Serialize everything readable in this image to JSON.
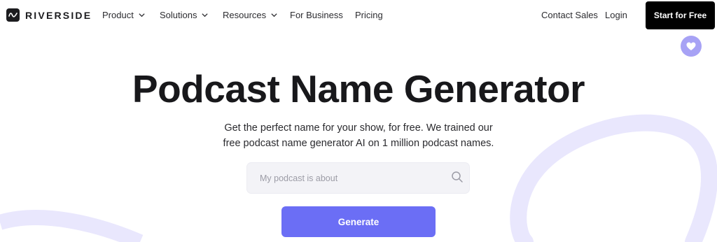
{
  "brand": {
    "name": "RIVERSIDE",
    "logo_icon": "waveform-icon"
  },
  "nav": {
    "items": [
      {
        "label": "Product",
        "has_dropdown": true
      },
      {
        "label": "Solutions",
        "has_dropdown": true
      },
      {
        "label": "Resources",
        "has_dropdown": true
      },
      {
        "label": "For Business",
        "has_dropdown": false
      },
      {
        "label": "Pricing",
        "has_dropdown": false
      }
    ],
    "contact_sales": "Contact Sales",
    "login": "Login",
    "cta": "Start for Free"
  },
  "hero": {
    "title": "Podcast Name Generator",
    "subtitle_line1": "Get the perfect name for your show, for free. We trained our",
    "subtitle_line2": "free podcast name generator AI on 1 million podcast names.",
    "search_placeholder": "My podcast is about",
    "search_value": "",
    "generate_label": "Generate"
  },
  "colors": {
    "accent": "#6b6ef5",
    "heart_badge": "#a7a2f5",
    "decor_stroke": "#e9e7fd",
    "cta_bg": "#000000"
  }
}
